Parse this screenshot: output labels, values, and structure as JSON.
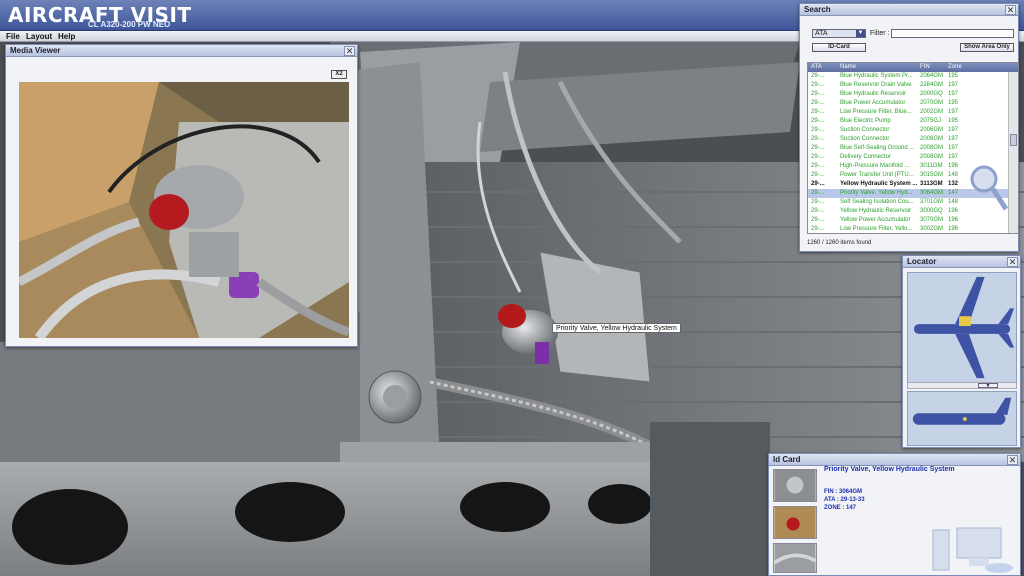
{
  "app": {
    "title": "AIRCRAFT VISIT",
    "subtitle": "CL A320-200 PW NEO"
  },
  "menu": [
    "File",
    "Layout",
    "Help"
  ],
  "media_viewer": {
    "title": "Media Viewer",
    "close": "✕",
    "zoom_button": "X2"
  },
  "search": {
    "title": "Search",
    "close": "✕",
    "ata_value": "ATA",
    "filter_label": "Filter :",
    "filter_value": "",
    "idcard_button": "ID-Card",
    "show_area_button": "Show Area Only",
    "columns": [
      "ATA",
      "Name",
      "FIN",
      "Zone"
    ],
    "rows": [
      {
        "ata": "29-...",
        "name": "Blue Hydraulic System Pr...",
        "fin": "2064GM",
        "zone": "195"
      },
      {
        "ata": "29-...",
        "name": "Blue Reservoir Drain Valve",
        "fin": "2284GM",
        "zone": "197"
      },
      {
        "ata": "29-...",
        "name": "Blue Hydraulic Reservoir",
        "fin": "2000GQ",
        "zone": "197"
      },
      {
        "ata": "29-...",
        "name": "Blue Power Accumulator",
        "fin": "2070GM",
        "zone": "195"
      },
      {
        "ata": "29-...",
        "name": "Low Pressure Filter, Blue...",
        "fin": "2002GM",
        "zone": "197"
      },
      {
        "ata": "29-...",
        "name": "Blue Electric Pump",
        "fin": "2075GJ",
        "zone": "195"
      },
      {
        "ata": "29-...",
        "name": "Suction Connector",
        "fin": "2006GM",
        "zone": "197"
      },
      {
        "ata": "29-...",
        "name": "Suction Connector",
        "fin": "2008GM",
        "zone": "197"
      },
      {
        "ata": "29-...",
        "name": "Blue Self-Sealing Ground ...",
        "fin": "2008GM",
        "zone": "197"
      },
      {
        "ata": "29-...",
        "name": "Delivery Connector",
        "fin": "2008GM",
        "zone": "197"
      },
      {
        "ata": "29-...",
        "name": "High-Pressure Manifold ...",
        "fin": "3011GM",
        "zone": "196"
      },
      {
        "ata": "29-...",
        "name": "Power Transfer Unit (PTU...",
        "fin": "3015GM",
        "zone": "148"
      },
      {
        "ata": "29-...",
        "name": "Yellow Hydraulic System ...",
        "fin": "3113GM",
        "zone": "132"
      },
      {
        "ata": "29-...",
        "name": "Priority Valve, Yellow Hyd...",
        "fin": "3064GM",
        "zone": "147"
      },
      {
        "ata": "29-...",
        "name": "Self Sealing Isolation Cou...",
        "fin": "3701GM",
        "zone": "148"
      },
      {
        "ata": "29-...",
        "name": "Yellow Hydraulic Reservoir",
        "fin": "3000GQ",
        "zone": "196"
      },
      {
        "ata": "29-...",
        "name": "Yellow Power Accumulator",
        "fin": "3070GM",
        "zone": "196"
      },
      {
        "ata": "29-...",
        "name": "Low Pressure Filter, Yello...",
        "fin": "3002GM",
        "zone": "196"
      }
    ],
    "status": "1260 / 1260 items found"
  },
  "locator": {
    "title": "Locator",
    "close": "✕"
  },
  "id_card": {
    "title": "Id Card",
    "close": "✕",
    "component_name": "Priority Valve, Yellow Hydraulic System",
    "fin": "FIN : 3064GM",
    "ata": "ATA : 29-13-33",
    "zone": "ZONE : 147"
  },
  "tooltip": "Priority Valve, Yellow Hydraulic System",
  "colors": {
    "title_bar": "#4a61a3",
    "panel_header": "#c7d1e8",
    "row_text": "#2fa02f",
    "id_text": "#1a2fb0"
  }
}
